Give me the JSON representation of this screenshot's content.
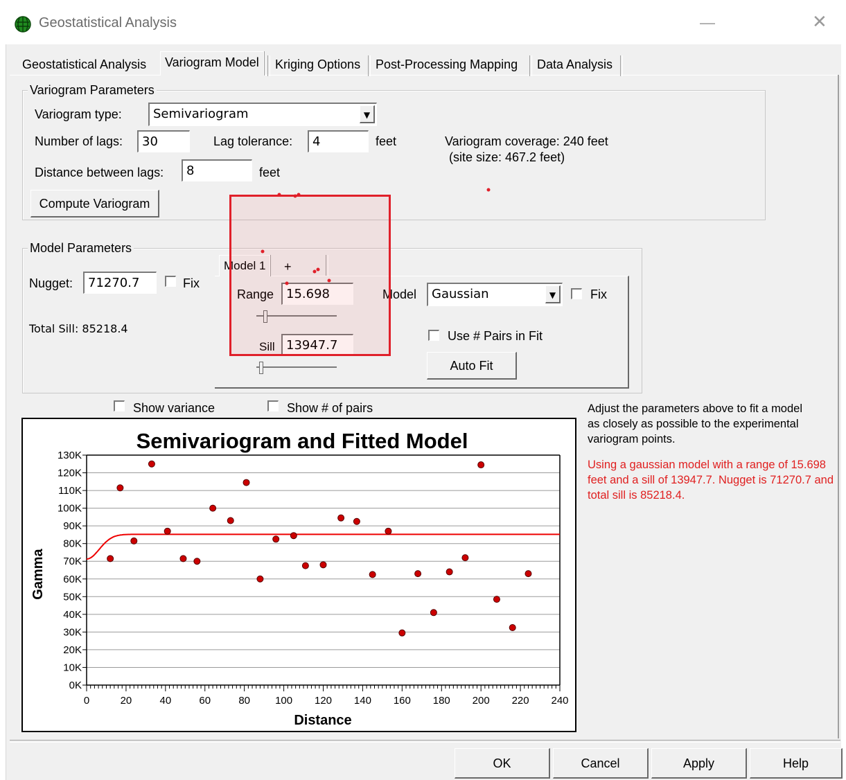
{
  "window": {
    "title": "Geostatistical Analysis",
    "minimize": "—",
    "close": "✕",
    "icon": "globe-icon"
  },
  "tabs": [
    {
      "label": "Geostatistical Analysis"
    },
    {
      "label": "Variogram Model"
    },
    {
      "label": "Kriging Options"
    },
    {
      "label": "Post-Processing Mapping"
    },
    {
      "label": "Data Analysis"
    }
  ],
  "variogram_params": {
    "group_label": "Variogram Parameters",
    "type_label": "Variogram type:",
    "type_value": "Semivariogram",
    "lags_label": "Number of lags:",
    "lags_value": "30",
    "tolerance_label": "Lag tolerance:",
    "tolerance_value": "4",
    "tolerance_unit": "feet",
    "coverage_line1": "Variogram coverage: 240 feet",
    "coverage_line2": "(site size: 467.2 feet)",
    "distance_label": "Distance between lags:",
    "distance_value": "8",
    "distance_unit": "feet",
    "compute_button": "Compute Variogram"
  },
  "model_params": {
    "group_label": "Model Parameters",
    "nugget_label": "Nugget:",
    "nugget_value": "71270.7",
    "fix_label": "Fix",
    "total_sill": "Total Sill: 85218.4",
    "model_tab": "Model 1",
    "add_tab": "+",
    "range_label": "Range",
    "range_value": "15.698",
    "sill_label": "Sill",
    "sill_value": "13947.7",
    "model_label": "Model",
    "model_value": "Gaussian",
    "model_fix_label": "Fix",
    "use_pairs_label": "Use # Pairs in Fit",
    "auto_fit_button": "Auto Fit"
  },
  "options": {
    "show_variance": "Show variance",
    "show_pairs": "Show # of pairs"
  },
  "info": {
    "help_text": "Adjust the parameters above to fit a model as closely as possible to the experimental variogram points.",
    "result_text": "Using a gaussian model with a range of 15.698 feet and a sill of 13947.7.  Nugget is 71270.7 and total sill is 85218.4.",
    "result_color": "#e02020"
  },
  "buttons": {
    "ok": "OK",
    "cancel": "Cancel",
    "apply": "Apply",
    "help": "Help"
  },
  "chart_data": {
    "type": "scatter",
    "title": "Semivariogram and Fitted Model",
    "xlabel": "Distance",
    "ylabel": "Gamma",
    "xlim": [
      0,
      240
    ],
    "ylim": [
      0,
      130000
    ],
    "xticks": [
      "0",
      "20",
      "40",
      "60",
      "80",
      "100",
      "120",
      "140",
      "160",
      "180",
      "200",
      "220",
      "240"
    ],
    "yticks": [
      "0K",
      "10K",
      "20K",
      "30K",
      "40K",
      "50K",
      "60K",
      "70K",
      "80K",
      "90K",
      "100K",
      "110K",
      "120K",
      "130K"
    ],
    "points": [
      [
        12,
        71500
      ],
      [
        17,
        111500
      ],
      [
        24,
        81500
      ],
      [
        33,
        125000
      ],
      [
        41,
        87000
      ],
      [
        49,
        71500
      ],
      [
        56,
        70000
      ],
      [
        64,
        100000
      ],
      [
        73,
        93000
      ],
      [
        81,
        114500
      ],
      [
        88,
        60000
      ],
      [
        96,
        82500
      ],
      [
        105,
        84500
      ],
      [
        111,
        67500
      ],
      [
        120,
        68000
      ],
      [
        129,
        94500
      ],
      [
        137,
        92500
      ],
      [
        145,
        62500
      ],
      [
        153,
        87000
      ],
      [
        160,
        29500
      ],
      [
        168,
        63000
      ],
      [
        176,
        41000
      ],
      [
        184,
        64000
      ],
      [
        192,
        72000
      ],
      [
        200,
        124500
      ],
      [
        208,
        48500
      ],
      [
        216,
        32500
      ],
      [
        224,
        63000
      ]
    ],
    "model": {
      "type": "gaussian",
      "nugget": 71270.7,
      "sill": 13947.7,
      "range": 15.698
    },
    "point_color": "#cc0000",
    "line_color": "#ee0000"
  }
}
